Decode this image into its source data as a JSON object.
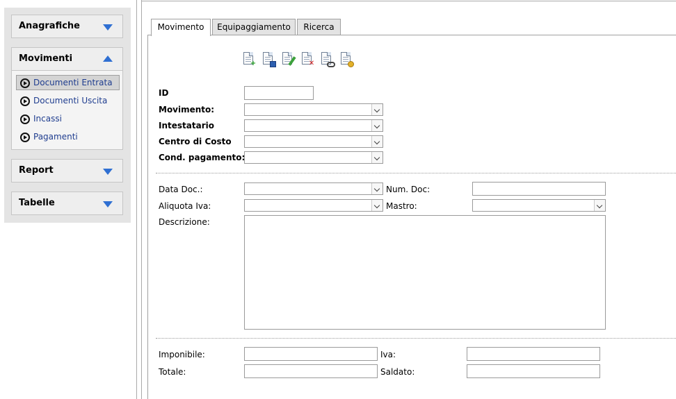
{
  "sidebar": {
    "sections": {
      "anagrafiche": "Anagrafiche",
      "movimenti": "Movimenti",
      "report": "Report",
      "tabelle": "Tabelle"
    },
    "movimenti_items": [
      "Documenti Entrata",
      "Documenti Uscita",
      "Incassi",
      "Pagamenti"
    ],
    "selected_item": "Documenti Entrata",
    "accent_color": "#2f6fd2"
  },
  "tabs": [
    "Movimento",
    "Equipaggiamento",
    "Ricerca"
  ],
  "active_tab": "Movimento",
  "toolbar": {
    "icons": [
      "new-document-icon",
      "save-document-icon",
      "edit-document-icon",
      "delete-document-icon",
      "search-document-icon",
      "print-document-icon"
    ]
  },
  "form": {
    "id_label": "ID",
    "movimento_label": "Movimento:",
    "intestatario_label": "Intestatario",
    "centro_costo_label": "Centro di Costo",
    "cond_pagamento_label": "Cond. pagamento:",
    "data_doc_label": "Data Doc.:",
    "num_doc_label": "Num. Doc:",
    "aliquota_iva_label": "Aliquota Iva:",
    "mastro_label": "Mastro:",
    "descrizione_label": "Descrizione:",
    "imponibile_label": "Imponibile:",
    "iva_label": "Iva:",
    "totale_label": "Totale:",
    "saldato_label": "Saldato:",
    "values": {
      "id": "",
      "movimento": "",
      "intestatario": "",
      "centro_costo": "",
      "cond_pagamento": "",
      "data_doc": "",
      "num_doc": "",
      "aliquota_iva": "",
      "mastro": "",
      "descrizione": "",
      "imponibile": "",
      "iva": "",
      "totale": "",
      "saldato": ""
    }
  }
}
